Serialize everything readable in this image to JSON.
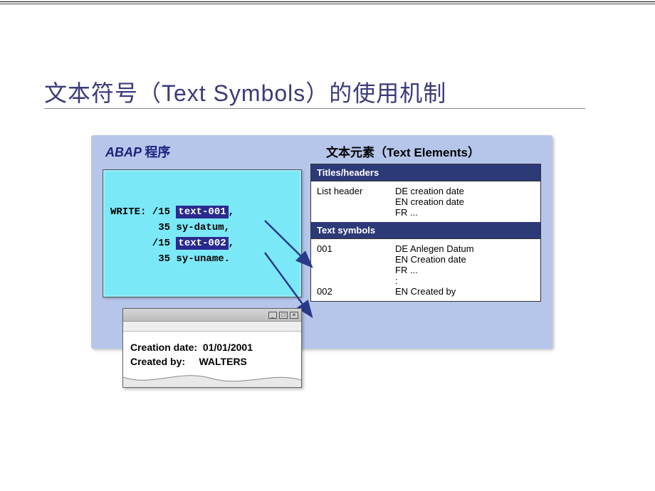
{
  "slide": {
    "title": "文本符号（Text Symbols）的使用机制"
  },
  "abap": {
    "label_prefix": "ABAP",
    "label_suffix": "程序",
    "code": {
      "l1_pre": "WRITE: /15 ",
      "l1_hl": "text-001",
      "l1_post": ",",
      "l2": "        35 sy-datum,",
      "l3_pre": "       /15 ",
      "l3_hl": "text-002",
      "l3_post": ",",
      "l4": "        35 sy-uname."
    }
  },
  "text_elements": {
    "label": "文本元素（Text Elements）",
    "headers_title": "Titles/headers",
    "headers": {
      "col1": "List header",
      "lines": [
        "DE creation date",
        "EN creation date",
        "FR  ..."
      ]
    },
    "symbols_title": "Text symbols",
    "symbols": [
      {
        "id": "001",
        "lines": [
          "DE Anlegen Datum",
          "EN Creation date",
          "FR  ...",
          "    :"
        ]
      },
      {
        "id": "002",
        "lines": [
          "EN  Created by"
        ]
      }
    ]
  },
  "output": {
    "row1_label": "Creation date:",
    "row1_value": "01/01/2001",
    "row2_label": "Created by:",
    "row2_value": "WALTERS"
  }
}
